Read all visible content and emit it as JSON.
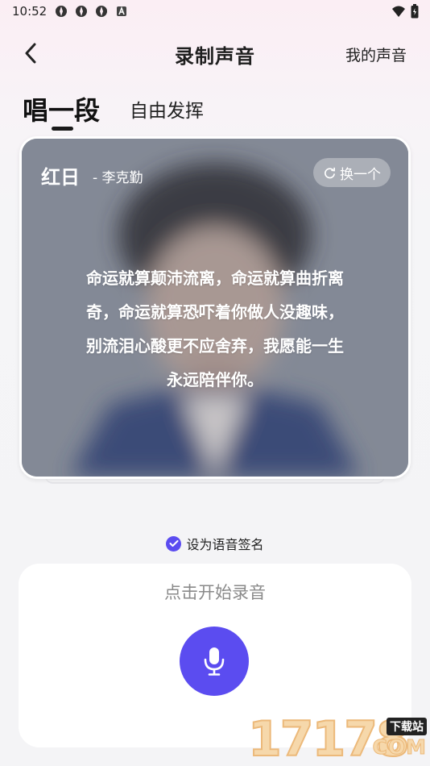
{
  "status_bar": {
    "time": "10:52"
  },
  "header": {
    "title": "录制声音",
    "my_voice": "我的声音"
  },
  "tabs": [
    {
      "label": "唱一段",
      "active": true
    },
    {
      "label": "自由发挥",
      "active": false
    }
  ],
  "song": {
    "title": "红日",
    "artist": "- 李克勤",
    "swap_label": "换一个",
    "lyrics": [
      "命运就算颠沛流离，命运就算曲折离",
      "奇，命运就算恐吓着你做人没趣味，",
      "别流泪心酸更不应舍弃，我愿能一生",
      "永远陪伴你。"
    ]
  },
  "signature": {
    "label": "设为语音签名",
    "checked": true
  },
  "record": {
    "hint": "点击开始录音"
  },
  "watermark": {
    "digits": "17178",
    "tag": "下载站",
    "com": "COM"
  },
  "colors": {
    "accent": "#5b4cf0",
    "card_bg": "#858b98"
  }
}
